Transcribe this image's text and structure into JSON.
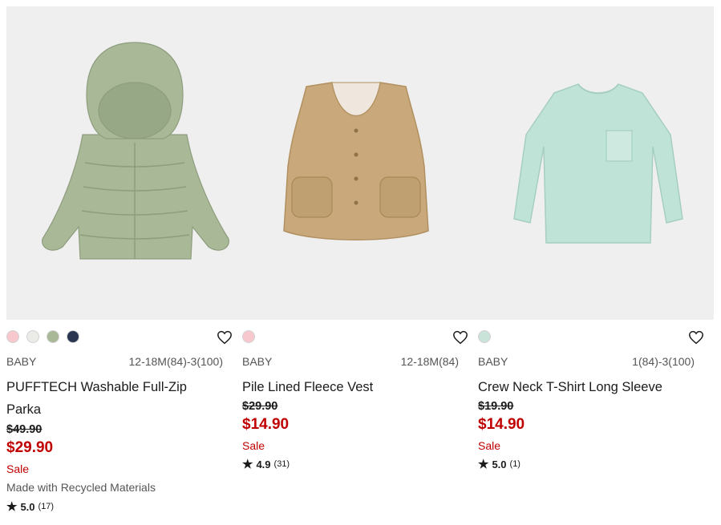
{
  "products": [
    {
      "category": "BABY",
      "sizes": "12-18M(84)-3(100)",
      "name": "PUFFTECH Washable Full-Zip Parka",
      "original_price": "$49.90",
      "sale_price": "$29.90",
      "sale_label": "Sale",
      "note": "Made with Recycled Materials",
      "rating": "5.0",
      "review_count": "(17)",
      "image_icon": "puffer-jacket",
      "swatches": [
        "#f7c9cf",
        "#ebebe8",
        "#a9b897",
        "#2a3550"
      ]
    },
    {
      "category": "BABY",
      "sizes": "12-18M(84)",
      "name": "Pile Lined Fleece Vest",
      "original_price": "$29.90",
      "sale_price": "$14.90",
      "sale_label": "Sale",
      "rating": "4.9",
      "review_count": "(31)",
      "image_icon": "fleece-vest",
      "swatches": [
        "#f7c9cf"
      ]
    },
    {
      "category": "BABY",
      "sizes": "1(84)-3(100)",
      "name": "Crew Neck T-Shirt Long Sleeve",
      "original_price": "$19.90",
      "sale_price": "$14.90",
      "sale_label": "Sale",
      "rating": "5.0",
      "review_count": "(1)",
      "image_icon": "long-sleeve-tshirt",
      "swatches": [
        "#c9e3d8"
      ]
    }
  ],
  "colors": {
    "sale": "#c00000",
    "image_background": "#efefef"
  }
}
